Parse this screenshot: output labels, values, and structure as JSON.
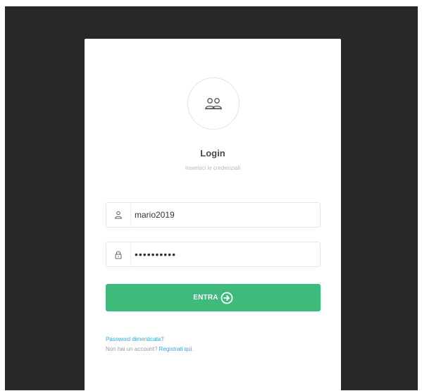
{
  "login": {
    "title": "Login",
    "subtitle": "Inserisci le credenziali",
    "username_value": "mario2019",
    "password_value": "••••••••••",
    "submit_label": "ENTRA",
    "forgot_password_link": "Password dimenticata?",
    "no_account_text": "Non hai un account?",
    "register_link": "Registrati qui."
  },
  "icons": {
    "avatar": "users-icon",
    "username": "user-icon",
    "password": "lock-icon",
    "submit": "arrow-right-circle-icon"
  },
  "colors": {
    "background": "#282828",
    "card": "#ffffff",
    "accent": "#3dba7c",
    "link": "#3aa6d8"
  }
}
